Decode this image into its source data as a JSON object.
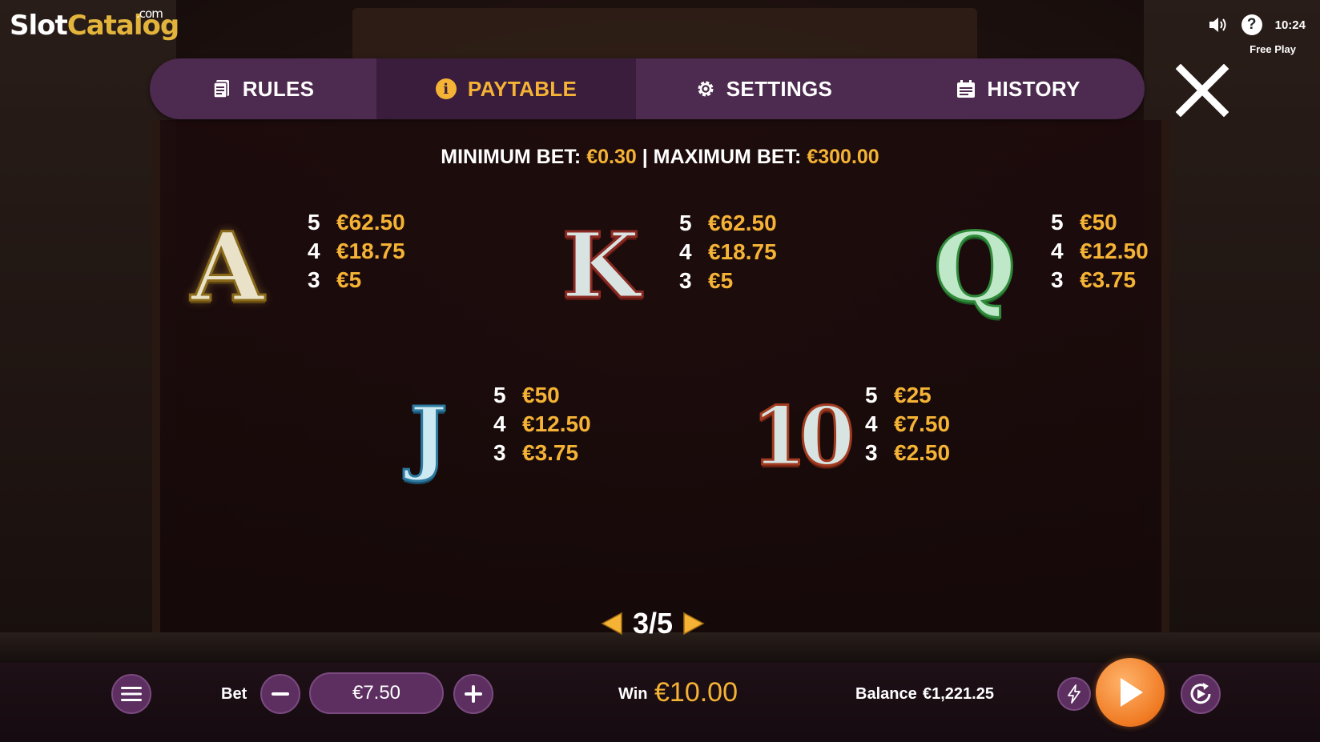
{
  "logo": {
    "part1": "Slot",
    "part2": "Catalog",
    "suffix": ".com"
  },
  "status": {
    "time": "10:24",
    "mode": "Free Play",
    "help_glyph": "?"
  },
  "tabs": [
    {
      "label": "RULES",
      "icon": "document-icon",
      "active": false
    },
    {
      "label": "PAYTABLE",
      "icon": "info-icon",
      "active": true
    },
    {
      "label": "SETTINGS",
      "icon": "gear-icon",
      "active": false
    },
    {
      "label": "HISTORY",
      "icon": "calendar-icon",
      "active": false
    }
  ],
  "bet_limits": {
    "min_label": "MINIMUM BET:",
    "min_value": "€0.30",
    "separator": "|",
    "max_label": "MAXIMUM BET:",
    "max_value": "€300.00"
  },
  "paytable": {
    "A": {
      "symbol": "A",
      "payouts": [
        {
          "count": "5",
          "amount": "€62.50"
        },
        {
          "count": "4",
          "amount": "€18.75"
        },
        {
          "count": "3",
          "amount": "€5"
        }
      ]
    },
    "K": {
      "symbol": "K",
      "payouts": [
        {
          "count": "5",
          "amount": "€62.50"
        },
        {
          "count": "4",
          "amount": "€18.75"
        },
        {
          "count": "3",
          "amount": "€5"
        }
      ]
    },
    "Q": {
      "symbol": "Q",
      "payouts": [
        {
          "count": "5",
          "amount": "€50"
        },
        {
          "count": "4",
          "amount": "€12.50"
        },
        {
          "count": "3",
          "amount": "€3.75"
        }
      ]
    },
    "J": {
      "symbol": "J",
      "payouts": [
        {
          "count": "5",
          "amount": "€50"
        },
        {
          "count": "4",
          "amount": "€12.50"
        },
        {
          "count": "3",
          "amount": "€3.75"
        }
      ]
    },
    "10": {
      "symbol": "10",
      "payouts": [
        {
          "count": "5",
          "amount": "€25"
        },
        {
          "count": "4",
          "amount": "€7.50"
        },
        {
          "count": "3",
          "amount": "€2.50"
        }
      ]
    }
  },
  "pager": {
    "indicator": "3/5",
    "current": 3,
    "total": 5
  },
  "bottom_bar": {
    "bet_label": "Bet",
    "bet_value": "€7.50",
    "win_label": "Win",
    "win_value": "€10.00",
    "balance_label": "Balance",
    "balance_value": "€1,221.25"
  },
  "colors": {
    "accent_gold": "#f5b335",
    "tab_bar": "#4d2a4f",
    "tab_active": "#3a1d3d",
    "spin_orange": "#f07a22",
    "button_purple": "#5c2f60"
  }
}
